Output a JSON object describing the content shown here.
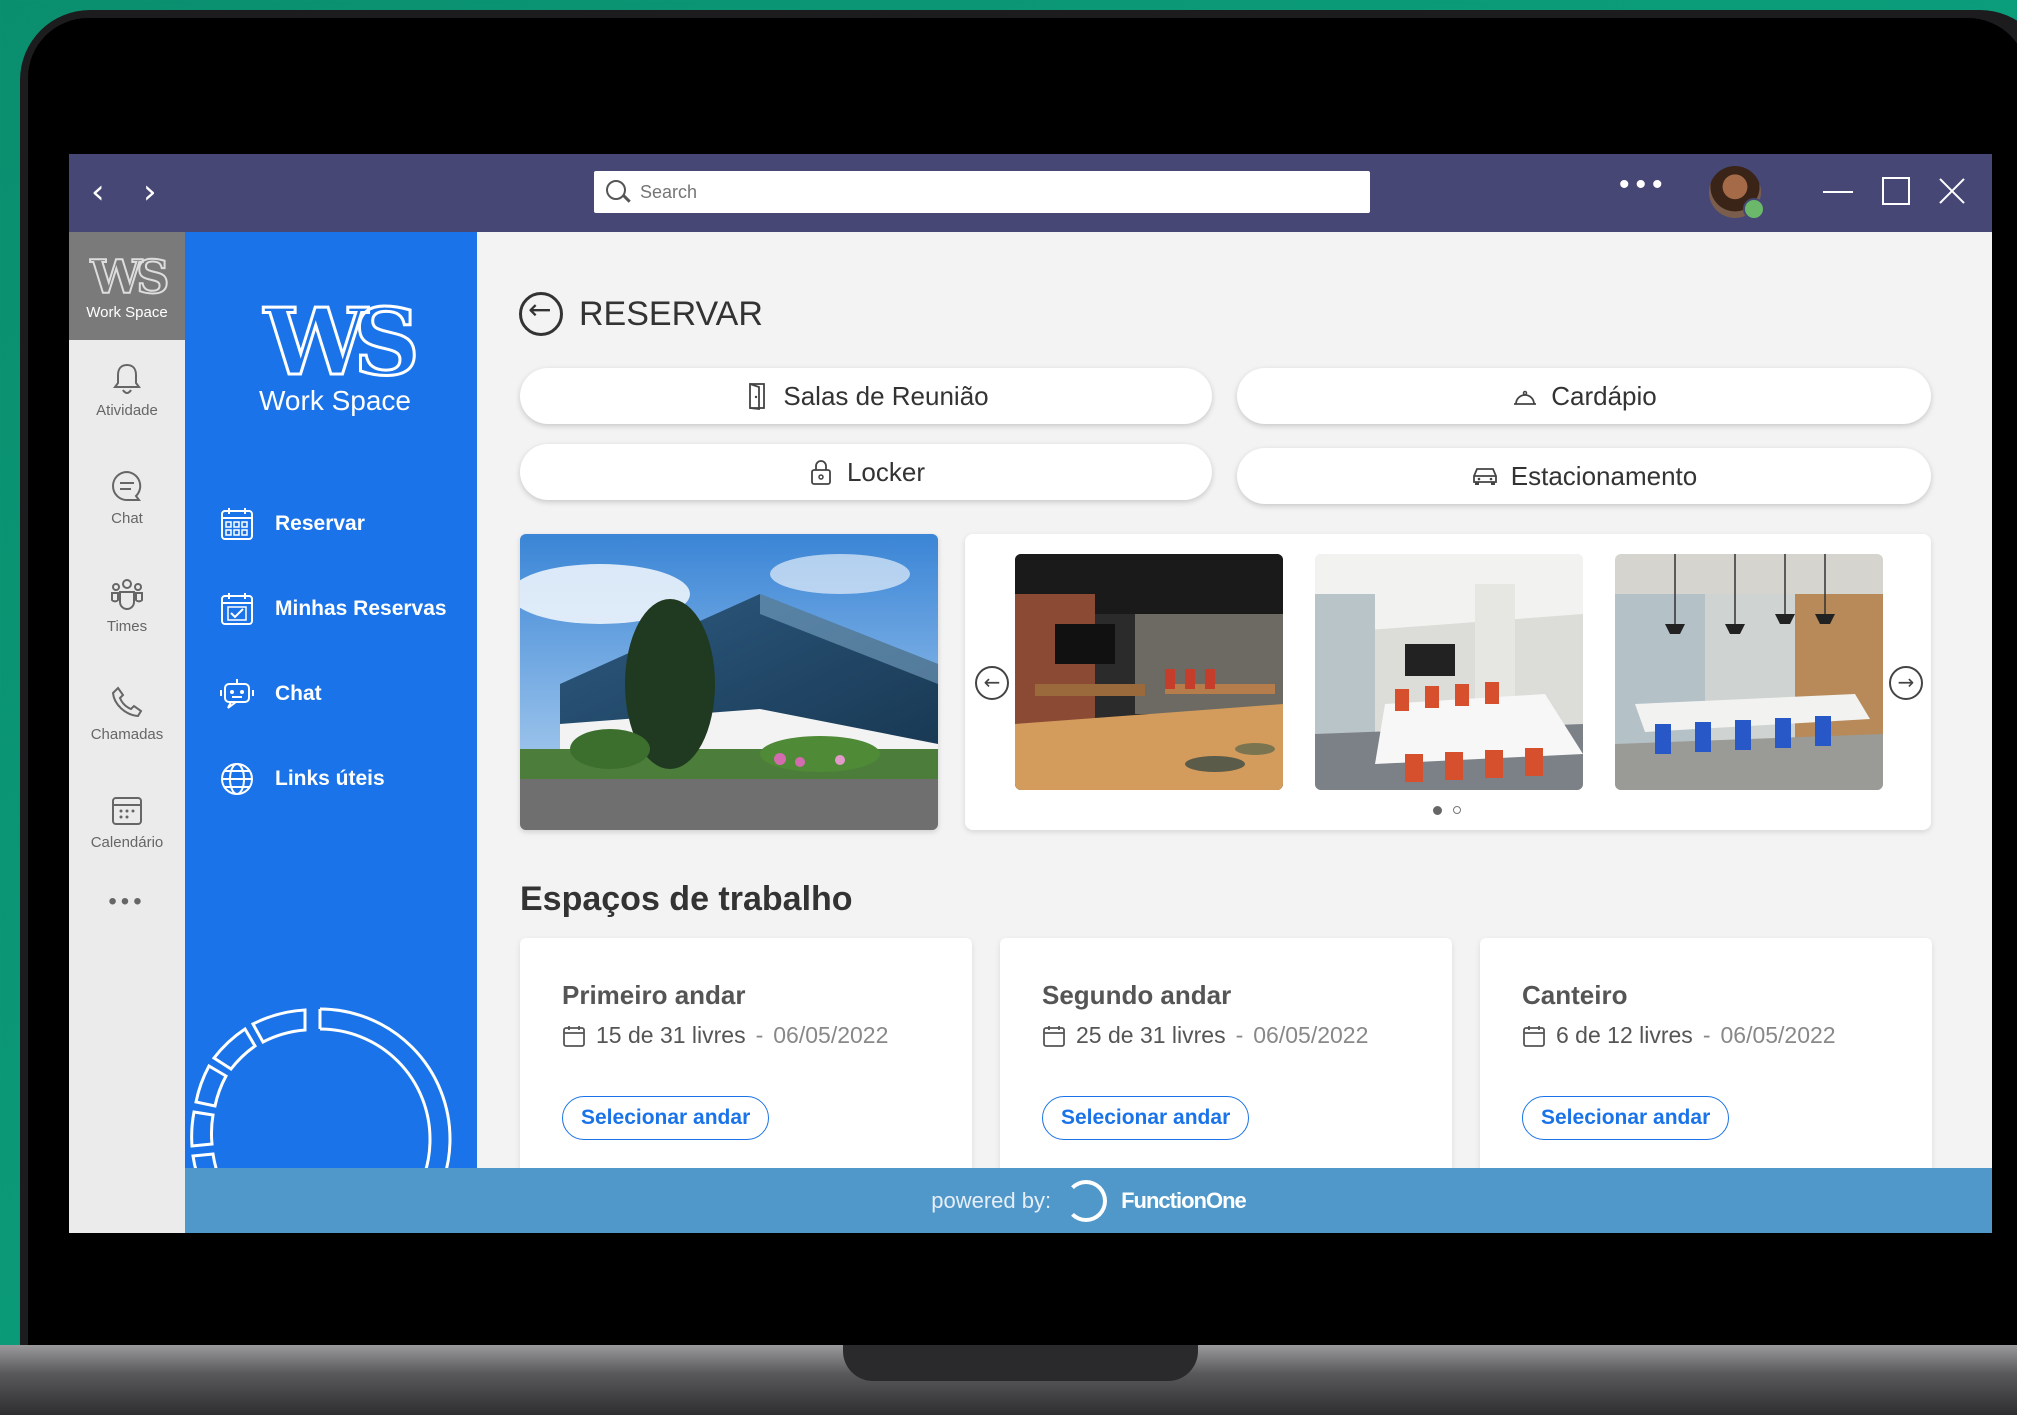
{
  "topbar": {
    "back_arrow": "‹",
    "forward_arrow": "›",
    "search_placeholder": "Search",
    "more": "•••"
  },
  "rail": {
    "workspace_logo": "WS",
    "workspace_label": "Work Space",
    "items": [
      {
        "label": "Atividade",
        "icon": "bell-icon"
      },
      {
        "label": "Chat",
        "icon": "chat-bubble-icon"
      },
      {
        "label": "Times",
        "icon": "teams-icon"
      },
      {
        "label": "Chamadas",
        "icon": "phone-icon"
      },
      {
        "label": "Calendário",
        "icon": "calendar-icon"
      }
    ],
    "more": "•••"
  },
  "sidebar": {
    "brand_logo": "WS",
    "brand_name": "Work Space",
    "items": [
      {
        "label": "Reservar",
        "icon": "calendar-grid-icon"
      },
      {
        "label": "Minhas Reservas",
        "icon": "calendar-check-icon"
      },
      {
        "label": "Chat",
        "icon": "bot-icon"
      },
      {
        "label": "Links úteis",
        "icon": "globe-icon"
      }
    ]
  },
  "main": {
    "title": "RESERVAR",
    "options": [
      {
        "label": "Salas de Reunião",
        "icon": "door-icon"
      },
      {
        "label": "Cardápio",
        "icon": "cloche-icon"
      },
      {
        "label": "Locker",
        "icon": "lock-icon"
      },
      {
        "label": "Estacionamento",
        "icon": "car-icon"
      }
    ],
    "carousel_prev": "←",
    "carousel_next": "→",
    "section_title": "Espaços de trabalho",
    "cards": [
      {
        "title": "Primeiro andar",
        "free": "15 de 31 livres",
        "date": "06/05/2022",
        "button": "Selecionar andar"
      },
      {
        "title": "Segundo andar",
        "free": "25 de 31 livres",
        "date": "06/05/2022",
        "button": "Selecionar andar"
      },
      {
        "title": "Canteiro",
        "free": "6 de 12 livres",
        "date": "06/05/2022",
        "button": "Selecionar andar"
      }
    ]
  },
  "footer": {
    "powered_by": "powered by:",
    "brand": "FunctionOne"
  },
  "colors": {
    "topbar": "#464775",
    "sidebar": "#1a73e8",
    "footer": "#4f98c9",
    "accent": "#1a73e8"
  }
}
